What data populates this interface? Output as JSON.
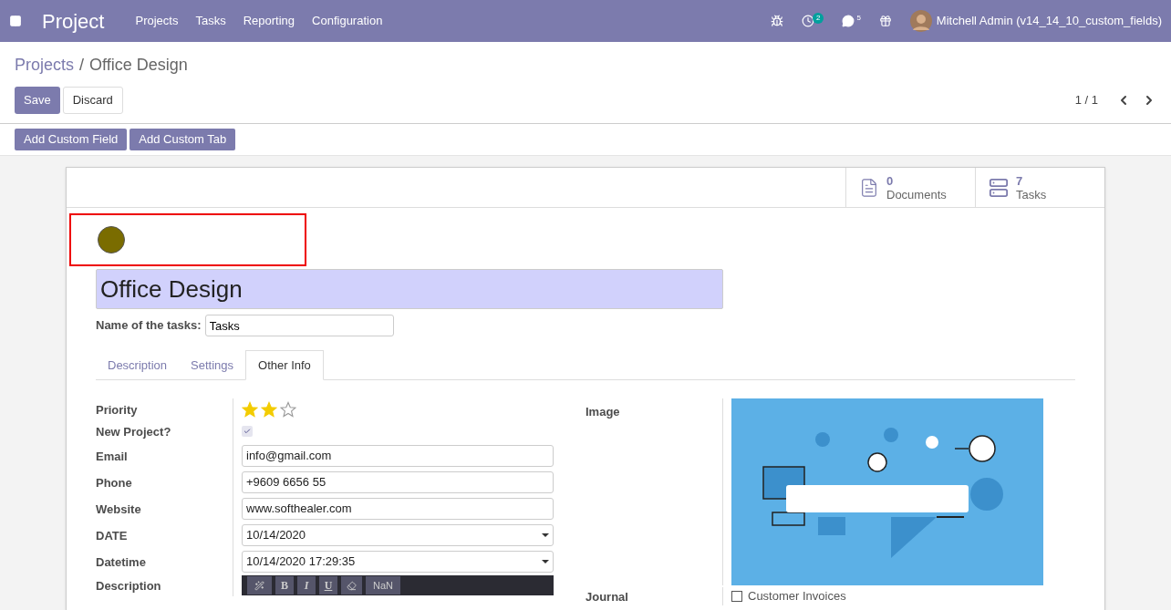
{
  "navbar": {
    "app_name": "Project",
    "menu": [
      "Projects",
      "Tasks",
      "Reporting",
      "Configuration"
    ],
    "activity_count": "2",
    "message_count": "5",
    "user": "Mitchell Admin (v14_14_10_custom_fields)"
  },
  "breadcrumb": {
    "parent": "Projects",
    "separator": "/",
    "current": "Office Design"
  },
  "actions": {
    "save": "Save",
    "discard": "Discard",
    "pager": "1 / 1"
  },
  "custom_buttons": [
    "Add Custom Field",
    "Add Custom Tab"
  ],
  "smart_buttons": [
    {
      "kind": "documents",
      "count": "0",
      "label": "Documents"
    },
    {
      "kind": "tasks",
      "count": "7",
      "label": "Tasks"
    }
  ],
  "color_dot": {
    "color": "#7a6c00"
  },
  "title": "Office Design",
  "task_name": {
    "label": "Name of the tasks:",
    "value": "Tasks"
  },
  "tabs": [
    {
      "label": "Description",
      "selected": false
    },
    {
      "label": "Settings",
      "selected": false
    },
    {
      "label": "Other Info",
      "selected": true
    }
  ],
  "fields": [
    {
      "kind": "stars",
      "label": "Priority",
      "stars": 2
    },
    {
      "kind": "checkbox",
      "label": "New Project?",
      "checked": true
    },
    {
      "kind": "text",
      "label": "Email",
      "value": "info@gmail.com"
    },
    {
      "kind": "text",
      "label": "Phone",
      "value": "+9609 6656 55"
    },
    {
      "kind": "text",
      "label": "Website",
      "value": "www.softhealer.com"
    },
    {
      "kind": "date",
      "label": "DATE",
      "value": "10/14/2020"
    },
    {
      "kind": "date",
      "label": "Datetime",
      "value": "10/14/2020 17:29:35"
    },
    {
      "kind": "editor",
      "label": "Description",
      "toolbar": [
        "B",
        "I",
        "U"
      ],
      "font_size": "NaN"
    }
  ],
  "right_fields": [
    {
      "label": "Image"
    },
    {
      "kind": "checklist",
      "label": "Journal",
      "options": [
        {
          "label": "Customer Invoices",
          "checked": false
        }
      ]
    }
  ]
}
